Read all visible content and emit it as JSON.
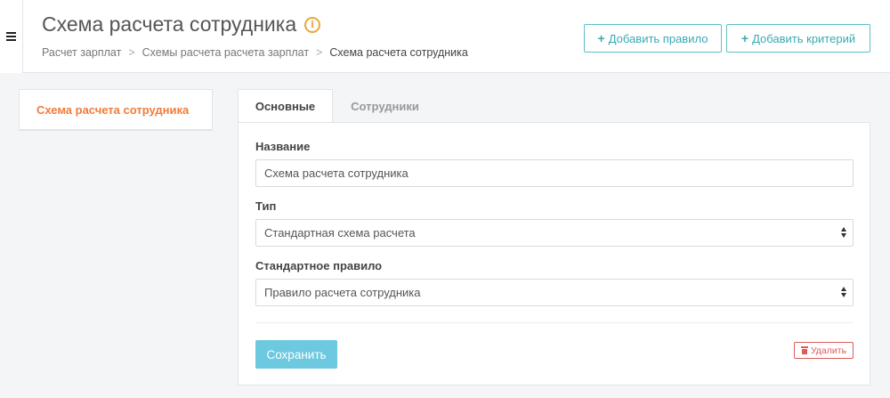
{
  "header": {
    "title": "Схема расчета сотрудника",
    "info_icon": "info-icon",
    "breadcrumb": [
      "Расчет зарплат",
      "Схемы расчета расчета зарплат",
      "Схема расчета сотрудника"
    ],
    "breadcrumb_separator": ">",
    "buttons": {
      "add_rule": "Добавить правило",
      "add_criterion": "Добавить критерий"
    },
    "plus_glyph": "+"
  },
  "sidebar": {
    "item_label": "Схема расчета сотрудника"
  },
  "tabs": [
    {
      "label": "Основные",
      "active": true
    },
    {
      "label": "Сотрудники",
      "active": false
    }
  ],
  "form": {
    "name": {
      "label": "Название",
      "value": "Схема расчета сотрудника"
    },
    "type": {
      "label": "Тип",
      "value": "Стандартная схема расчета"
    },
    "standard_rule": {
      "label": "Стандартное правило",
      "value": "Правило расчета сотрудника"
    },
    "save_label": "Сохранить",
    "delete_label": "Удалить"
  },
  "colors": {
    "accent_orange": "#f07c3a",
    "teal": "#3aa9b3",
    "save_blue": "#6cc9e0",
    "danger": "#e05a5a",
    "info_yellow": "#e8a93a"
  }
}
